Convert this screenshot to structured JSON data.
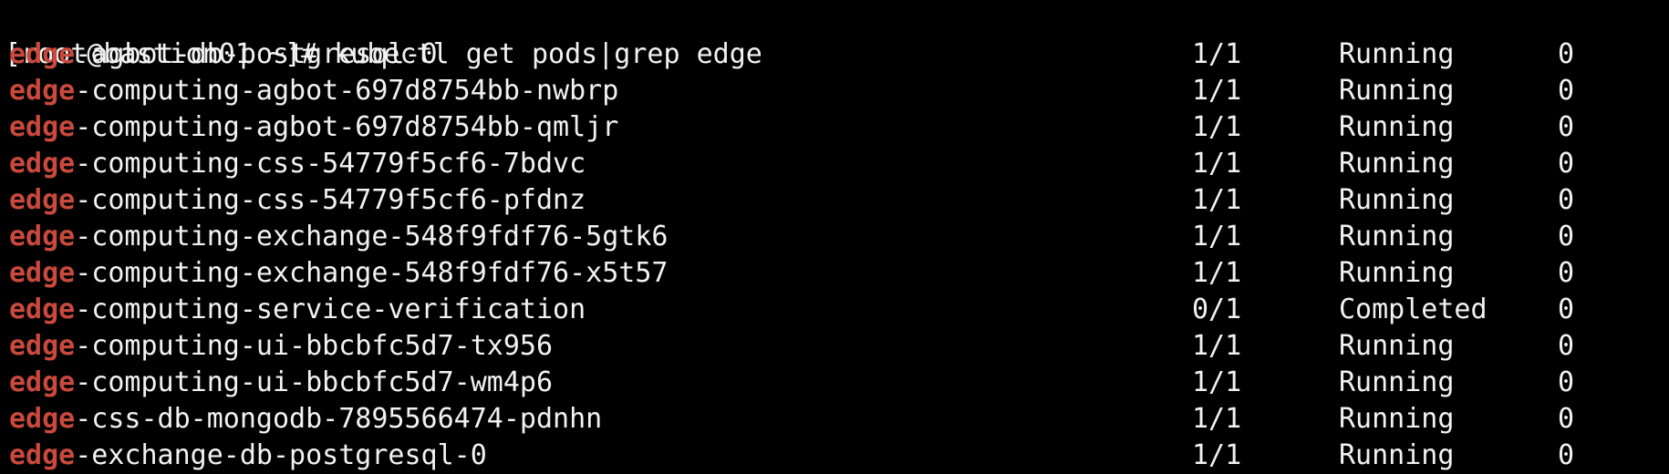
{
  "terminal": {
    "prompt": "[root@bastion01 ~]# ",
    "command": "kubectl get pods|grep edge",
    "highlight_color": "#c9493c",
    "text_color": "#f2f2f2",
    "background_color": "#000000",
    "rows": [
      {
        "match": "edge",
        "rest": "-agbot-db-postgresql-0",
        "ready": "1/1",
        "status": "Running",
        "restarts": "0"
      },
      {
        "match": "edge",
        "rest": "-computing-agbot-697d8754bb-nwbrp",
        "ready": "1/1",
        "status": "Running",
        "restarts": "0"
      },
      {
        "match": "edge",
        "rest": "-computing-agbot-697d8754bb-qmljr",
        "ready": "1/1",
        "status": "Running",
        "restarts": "0"
      },
      {
        "match": "edge",
        "rest": "-computing-css-54779f5cf6-7bdvc",
        "ready": "1/1",
        "status": "Running",
        "restarts": "0"
      },
      {
        "match": "edge",
        "rest": "-computing-css-54779f5cf6-pfdnz",
        "ready": "1/1",
        "status": "Running",
        "restarts": "0"
      },
      {
        "match": "edge",
        "rest": "-computing-exchange-548f9fdf76-5gtk6",
        "ready": "1/1",
        "status": "Running",
        "restarts": "0"
      },
      {
        "match": "edge",
        "rest": "-computing-exchange-548f9fdf76-x5t57",
        "ready": "1/1",
        "status": "Running",
        "restarts": "0"
      },
      {
        "match": "edge",
        "rest": "-computing-service-verification",
        "ready": "0/1",
        "status": "Completed",
        "restarts": "0"
      },
      {
        "match": "edge",
        "rest": "-computing-ui-bbcbfc5d7-tx956",
        "ready": "1/1",
        "status": "Running",
        "restarts": "0"
      },
      {
        "match": "edge",
        "rest": "-computing-ui-bbcbfc5d7-wm4p6",
        "ready": "1/1",
        "status": "Running",
        "restarts": "0"
      },
      {
        "match": "edge",
        "rest": "-css-db-mongodb-7895566474-pdnhn",
        "ready": "1/1",
        "status": "Running",
        "restarts": "0"
      },
      {
        "match": "edge",
        "rest": "-exchange-db-postgresql-0",
        "ready": "1/1",
        "status": "Running",
        "restarts": "0"
      }
    ]
  }
}
